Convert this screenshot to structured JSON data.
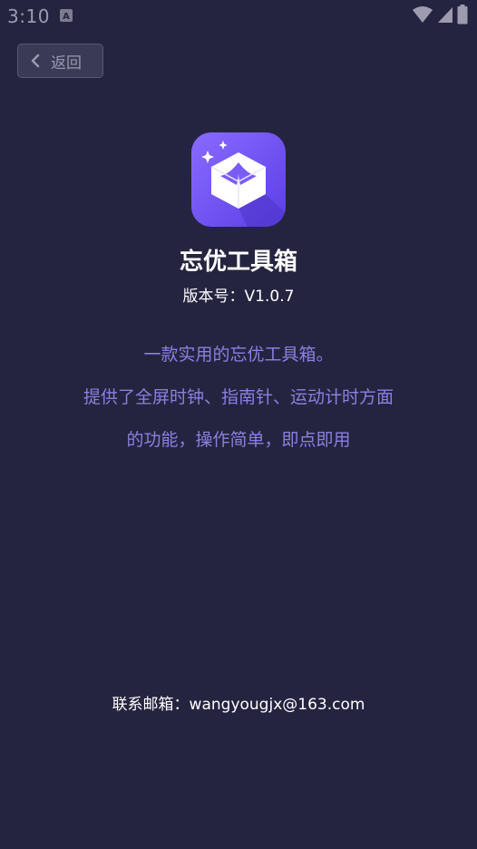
{
  "status_bar": {
    "time": "3:10"
  },
  "nav": {
    "back_label": "返回"
  },
  "app": {
    "name": "忘优工具箱",
    "version": "版本号：V1.0.7"
  },
  "description": {
    "lines": [
      "一款实用的忘优工具箱。",
      "提供了全屏时钟、指南针、运动计时方面",
      "的功能，操作简单，即点即用"
    ]
  },
  "contact": {
    "text": "联系邮箱：wangyougjx@163.com"
  },
  "colors": {
    "background": "#252440",
    "accent_text": "#8c7fe0",
    "icon_gradient_start": "#8a6bff",
    "icon_gradient_end": "#5b3ee6"
  },
  "icons": {
    "status_notification": "notification-a-icon",
    "wifi": "wifi-icon",
    "signal": "signal-icon",
    "battery": "battery-icon",
    "back": "chevron-left-icon",
    "app_logo": "toolbox-box-icon"
  }
}
